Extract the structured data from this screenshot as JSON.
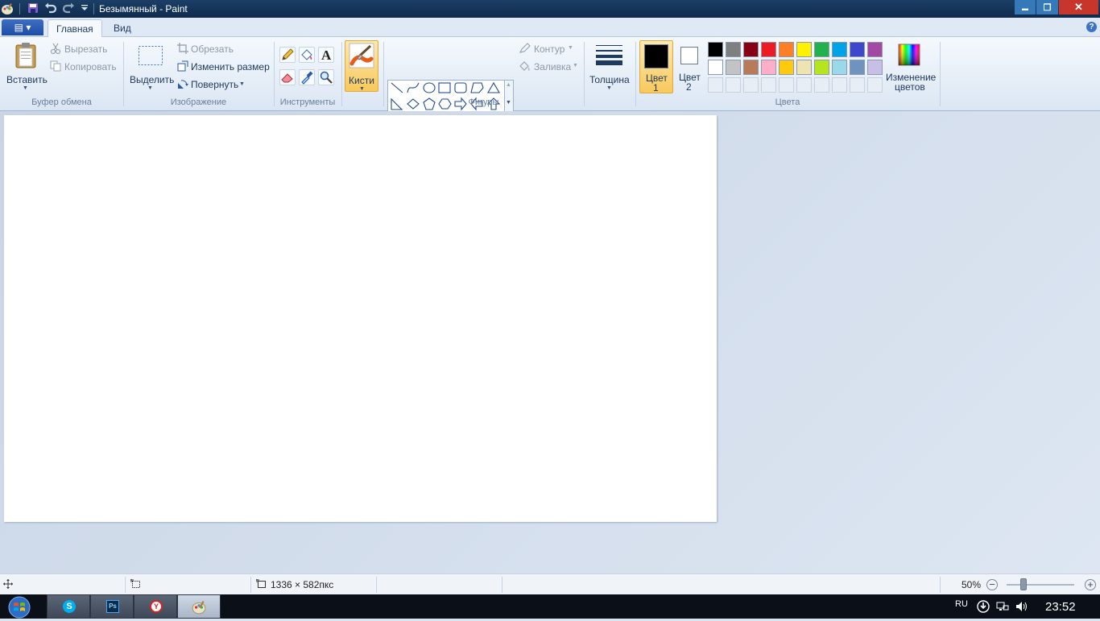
{
  "window": {
    "title": "Безымянный - Paint",
    "controls": {
      "minimize": "▬",
      "restore": "❐",
      "close": "✕"
    }
  },
  "tabs": {
    "file_menu": "▤ ▾",
    "home": "Главная",
    "view": "Вид",
    "help": "?"
  },
  "ribbon": {
    "clipboard": {
      "label": "Буфер обмена",
      "paste": "Вставить",
      "cut": "Вырезать",
      "copy": "Копировать"
    },
    "image": {
      "label": "Изображение",
      "select": "Выделить",
      "crop": "Обрезать",
      "resize": "Изменить размер",
      "rotate": "Повернуть"
    },
    "tools": {
      "label": "Инструменты",
      "text_tool_glyph": "A"
    },
    "brushes": {
      "label": "Кисти"
    },
    "shapes": {
      "label": "Фигуры",
      "outline": "Контур",
      "fill": "Заливка"
    },
    "size": {
      "label": "Толщина"
    },
    "colors": {
      "label": "Цвета",
      "color1_line1": "Цвет",
      "color1_line2": "1",
      "color2_line1": "Цвет",
      "color2_line2": "2",
      "edit_line1": "Изменение",
      "edit_line2": "цветов",
      "color1_value": "#000000",
      "color2_value": "#ffffff",
      "palette_row1": [
        "#000000",
        "#7f7f7f",
        "#880015",
        "#ed1c24",
        "#ff7f27",
        "#fff200",
        "#22b14c",
        "#00a2e8",
        "#3f48cc",
        "#a349a4"
      ],
      "palette_row2": [
        "#ffffff",
        "#c3c3c3",
        "#b97a57",
        "#ffaec9",
        "#ffc90e",
        "#efe4b0",
        "#b5e61d",
        "#99d9ea",
        "#7092be",
        "#c8bfe7"
      ]
    }
  },
  "statusbar": {
    "canvas_size": "1336 × 582пкс",
    "zoom": "50%",
    "zoom_minus": "−",
    "zoom_plus": "+",
    "zoom_fraction": 0.25
  },
  "taskbar": {
    "lang": "RU",
    "time": "23:52",
    "skype_glyph": "S",
    "ps_glyph": "Ps",
    "yandex_glyph": "Y"
  }
}
